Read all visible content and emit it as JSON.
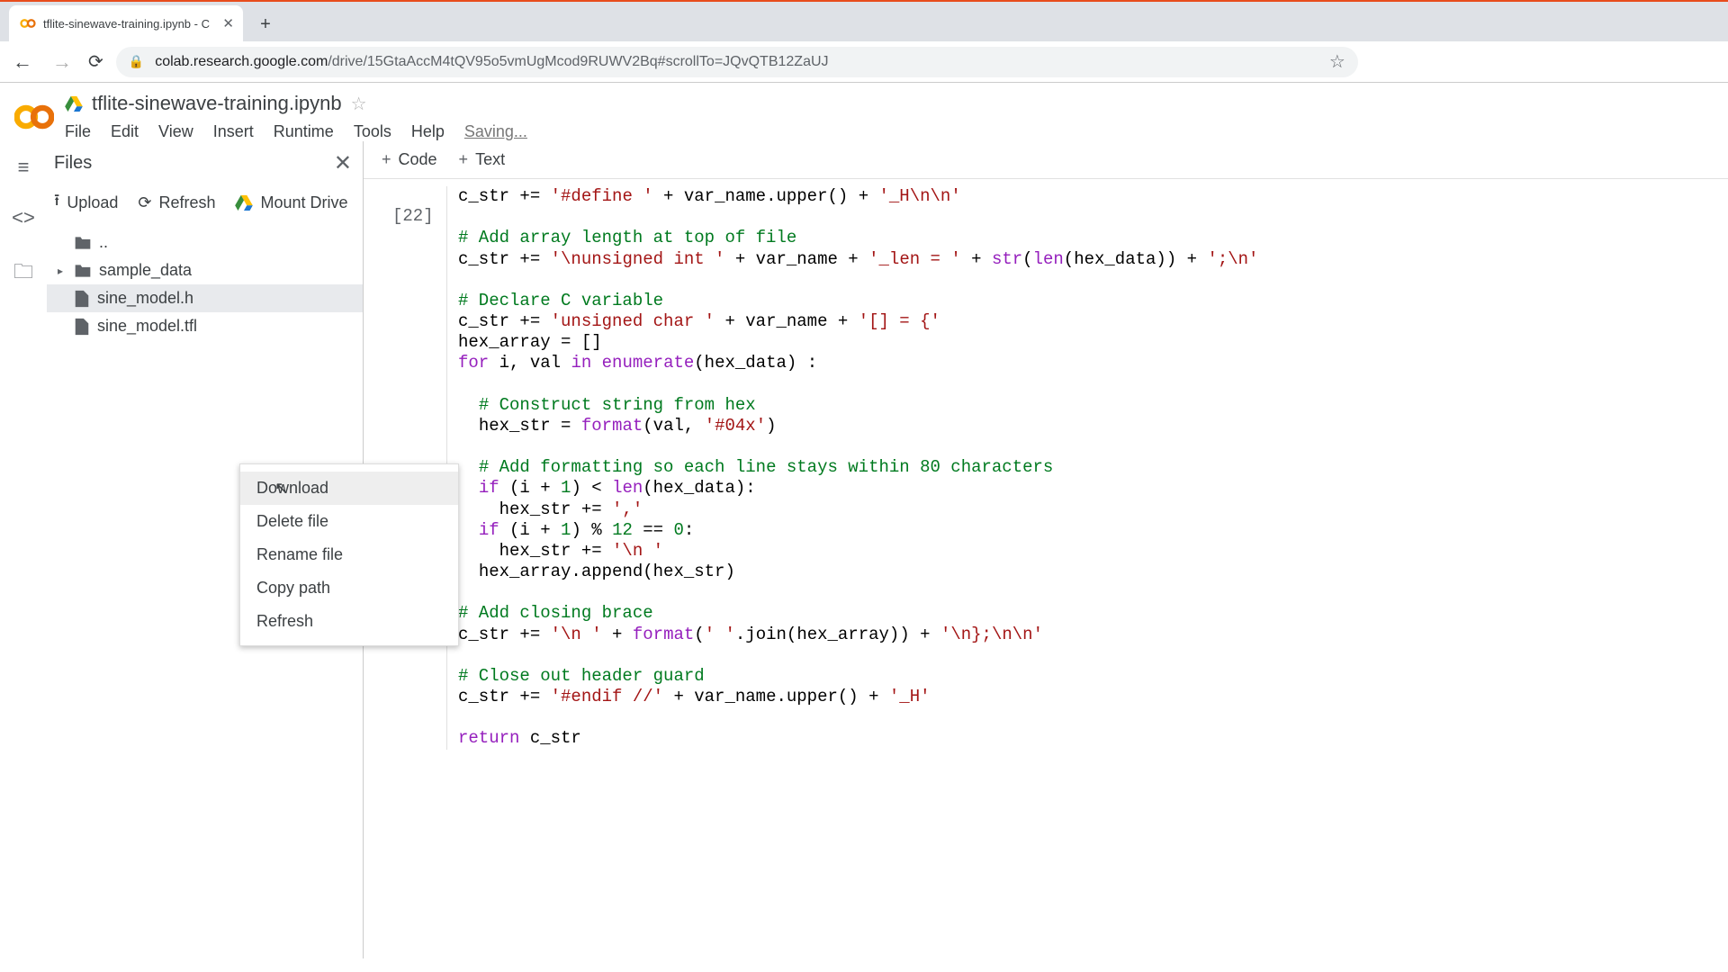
{
  "browser": {
    "tab_title": "tflite-sinewave-training.ipynb - C",
    "url_domain": "colab.research.google.com",
    "url_path": "/drive/15GtaAccM4tQV95o5vmUgMcod9RUWV2Bq#scrollTo=JQvQTB12ZaUJ"
  },
  "colab": {
    "notebook_title": "tflite-sinewave-training.ipynb",
    "menu": {
      "file": "File",
      "edit": "Edit",
      "view": "View",
      "insert": "Insert",
      "runtime": "Runtime",
      "tools": "Tools",
      "help": "Help",
      "saving": "Saving..."
    }
  },
  "files_panel": {
    "title": "Files",
    "upload": "Upload",
    "refresh": "Refresh",
    "mount_drive": "Mount Drive",
    "tree": {
      "parent": "..",
      "sample_data": "sample_data",
      "sine_model_h": "sine_model.h",
      "sine_model_tflite": "sine_model.tfl"
    }
  },
  "context_menu": {
    "download": "Download",
    "delete": "Delete file",
    "rename": "Rename file",
    "copy_path": "Copy path",
    "refresh": "Refresh"
  },
  "toolbar": {
    "code": "Code",
    "text": "Text"
  },
  "cell": {
    "execution_count": "[22]"
  },
  "code_tokens": {
    "line0a": "c_str += ",
    "line0b": "'#define '",
    "line0c": " + var_name.upper() + ",
    "line0d": "'_H\\n\\n'",
    "c1": "# Add array length at top of file",
    "l2a": "c_str += ",
    "l2b": "'\\nunsigned int '",
    "l2c": " + var_name + ",
    "l2d": "'_len = '",
    "l2e": " + ",
    "l2f": "str",
    "l2g": "(",
    "l2h": "len",
    "l2i": "(hex_data)) + ",
    "l2j": "';\\n'",
    "c3": "# Declare C variable",
    "l4a": "c_str += ",
    "l4b": "'unsigned char '",
    "l4c": " + var_name + ",
    "l4d": "'[] = {'",
    "l5": "hex_array = []",
    "l6a": "for",
    "l6b": " i, val ",
    "l6c": "in",
    "l6d": " ",
    "l6e": "enumerate",
    "l6f": "(hex_data) :",
    "c7": "# Construct string from hex",
    "l8a": "hex_str = ",
    "l8b": "format",
    "l8c": "(val, ",
    "l8d": "'#04x'",
    "l8e": ")",
    "c9": "# Add formatting so each line stays within 80 characters",
    "l10a": "if",
    "l10b": " (i + ",
    "l10c": "1",
    "l10d": ") < ",
    "l10e": "len",
    "l10f": "(hex_data):",
    "l11a": "hex_str += ",
    "l11b": "','",
    "l12a": "if",
    "l12b": " (i + ",
    "l12c": "1",
    "l12d": ") % ",
    "l12e": "12",
    "l12f": " == ",
    "l12g": "0",
    "l12h": ":",
    "l13a": "hex_str += ",
    "l13b": "'\\n '",
    "l14": "hex_array.append(hex_str)",
    "c15": "# Add closing brace",
    "l16a": "c_str += ",
    "l16b": "'\\n '",
    "l16c": " + ",
    "l16d": "format",
    "l16e": "(",
    "l16f": "' '",
    "l16g": ".join(hex_array)) + ",
    "l16h": "'\\n};\\n\\n'",
    "c17": "# Close out header guard",
    "l18a": "c_str += ",
    "l18b": "'#endif //'",
    "l18c": " + var_name.upper() + ",
    "l18d": "'_H'",
    "l19a": "return",
    "l19b": " c_str"
  }
}
